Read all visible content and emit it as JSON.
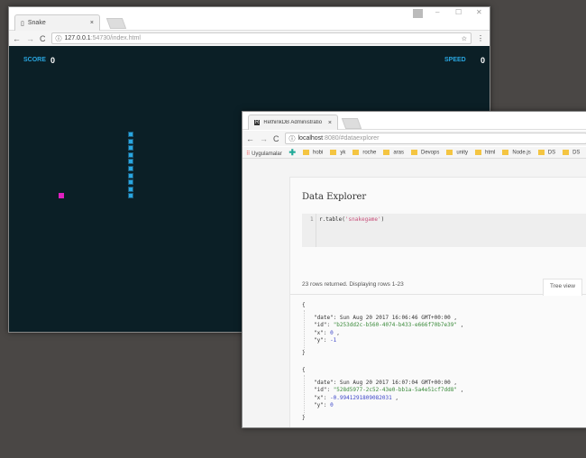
{
  "snake_window": {
    "tab_title": "Snake",
    "url_host": "127.0.0.1",
    "url_rest": ":54730/index.html",
    "score_label": "SCORE",
    "score_value": "0",
    "speed_label": "SPEED",
    "speed_value": "0",
    "colors": {
      "background": "#0b1f26",
      "snake": "#29a6e0",
      "food": "#e020c0",
      "label": "#29a6e0"
    }
  },
  "rethink_window": {
    "tab_title": "RethinkDB Administratio",
    "url_host": "localhost",
    "url_rest": ":8080/#dataexplorer",
    "bookmarks": [
      "Uygulamalar",
      "hobi",
      "yk",
      "roche",
      "aras",
      "Devops",
      "unity",
      "html",
      "Node.js",
      "DS",
      "DS"
    ],
    "page_title": "Data Explorer",
    "query_line_number": "1",
    "query_prefix": "r.table(",
    "query_string": "'snakegame'",
    "query_suffix": ")",
    "result_summary": "23 rows returned. Displaying rows 1-23",
    "view_tab": "Tree view",
    "rows": [
      {
        "date": "Sun Aug 20 2017 16:06:46 GMT+00:00",
        "id": "\"b253dd2c-b560-4074-b433-e666f70b7e39\"",
        "x": "0",
        "y": "-1"
      },
      {
        "date": "Sun Aug 20 2017 16:07:04 GMT+00:00",
        "id": "\"528d5977-2c52-43e0-bb1a-5a4e51cf7dd8\"",
        "x": "-0.9941291809082031",
        "y": "0"
      }
    ]
  }
}
